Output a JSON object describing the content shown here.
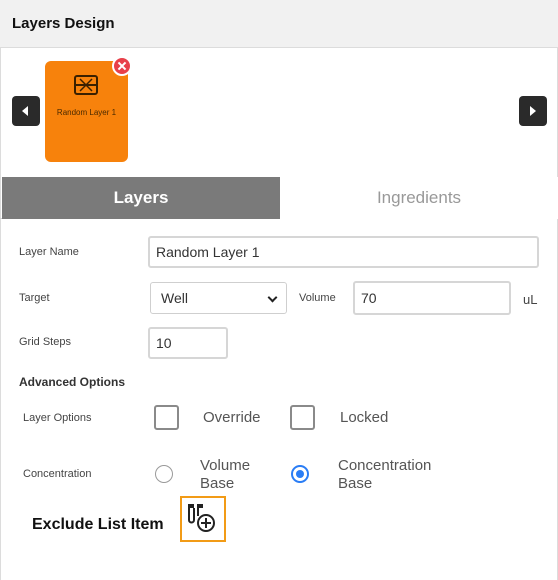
{
  "header": {
    "title": "Layers Design"
  },
  "layers_carousel": {
    "cards": [
      {
        "label": "Random Layer 1",
        "color": "#f7820c"
      }
    ],
    "prev_icon": "caret-left-icon",
    "next_icon": "caret-right-icon",
    "remove_icon": "close-icon"
  },
  "tabs": [
    {
      "label": "Layers",
      "active": true
    },
    {
      "label": "Ingredients",
      "active": false
    }
  ],
  "form": {
    "layer_name": {
      "label": "Layer Name",
      "value": "Random Layer 1"
    },
    "target": {
      "label": "Target",
      "value": "Well"
    },
    "volume": {
      "label": "Volume",
      "value": "70",
      "unit": "uL"
    },
    "grid_steps": {
      "label": "Grid Steps",
      "value": "10"
    },
    "advanced_options": {
      "heading": "Advanced Options"
    },
    "layer_options": {
      "label": "Layer Options",
      "override": {
        "label": "Override",
        "checked": false
      },
      "locked": {
        "label": "Locked",
        "checked": false
      }
    },
    "concentration": {
      "label": "Concentration",
      "volume_base": {
        "label_line1": "Volume",
        "label_line2": "Base",
        "selected": false
      },
      "concentration_base": {
        "label_line1": "Concentration",
        "label_line2": "Base",
        "selected": true
      }
    }
  },
  "exclude": {
    "label": "Exclude List Item",
    "icon": "add-tubes-icon"
  },
  "colors": {
    "accent": "#f7820c",
    "highlight": "#f29b16",
    "radio": "#2a7df5",
    "active_tab": "#7a7a7a"
  }
}
